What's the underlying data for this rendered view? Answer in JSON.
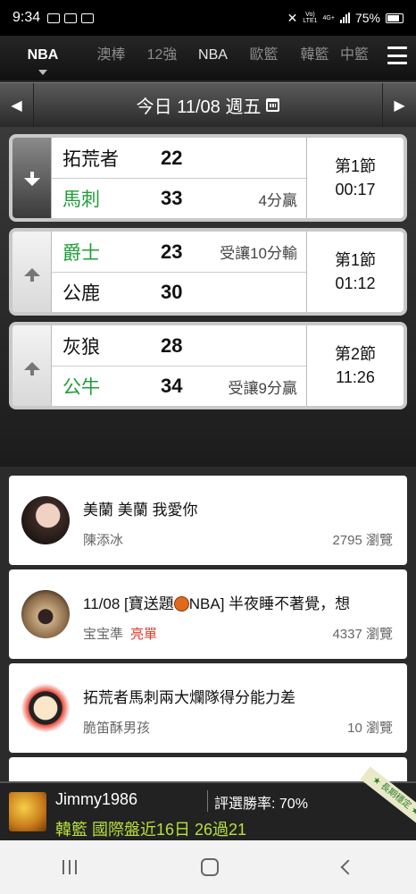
{
  "status_bar": {
    "time": "9:34",
    "network": "4G+",
    "network_sub": "LTE1",
    "volte": "Vo)",
    "battery": "75%"
  },
  "league_tabs": [
    {
      "label": "NBA",
      "active": true
    },
    {
      "label": "澳棒"
    },
    {
      "label": "12強"
    },
    {
      "label": "NBA"
    },
    {
      "label": "歐籃"
    },
    {
      "label": "韓籃"
    },
    {
      "label": "中籃"
    }
  ],
  "date_bar": {
    "label": "今日 11/08 週五"
  },
  "games": [
    {
      "team1": "拓荒者",
      "score1": "22",
      "note1": "",
      "team2": "馬刺",
      "score2": "33",
      "note2": "4分贏",
      "period": "第1節",
      "clock": "00:17",
      "winner": 2
    },
    {
      "team1": "爵士",
      "score1": "23",
      "note1": "受讓10分輸",
      "team2": "公鹿",
      "score2": "30",
      "note2": "",
      "period": "第1節",
      "clock": "01:12",
      "winner": 1
    },
    {
      "team1": "灰狼",
      "score1": "28",
      "note1": "",
      "team2": "公牛",
      "score2": "34",
      "note2": "受讓9分贏",
      "period": "第2節",
      "clock": "11:26",
      "winner": 2
    }
  ],
  "posts": [
    {
      "title": "美蘭 美蘭 我愛你",
      "author": "陳添冰",
      "tag": "",
      "views": "2795 瀏覽"
    },
    {
      "title_pre": "11/08 [寶送題",
      "title_post": "NBA] 半夜睡不著覺，想",
      "author": "宝宝準",
      "tag": "亮單",
      "views": "4337 瀏覽"
    },
    {
      "title": "拓荒者馬刺兩大爛隊得分能力差",
      "author": "脆笛酥男孩",
      "tag": "",
      "views": "10 瀏覽"
    }
  ],
  "banner": {
    "username": "Jimmy1986",
    "winrate": "評選勝率: 70%",
    "record": "韓籃 國際盤近16日 26過21",
    "ribbon": "★ 長期穩定 ★"
  },
  "colors": {
    "win_green": "#1f9d3a",
    "tag_red": "#e03b2a",
    "record_green": "#b8e23a"
  }
}
